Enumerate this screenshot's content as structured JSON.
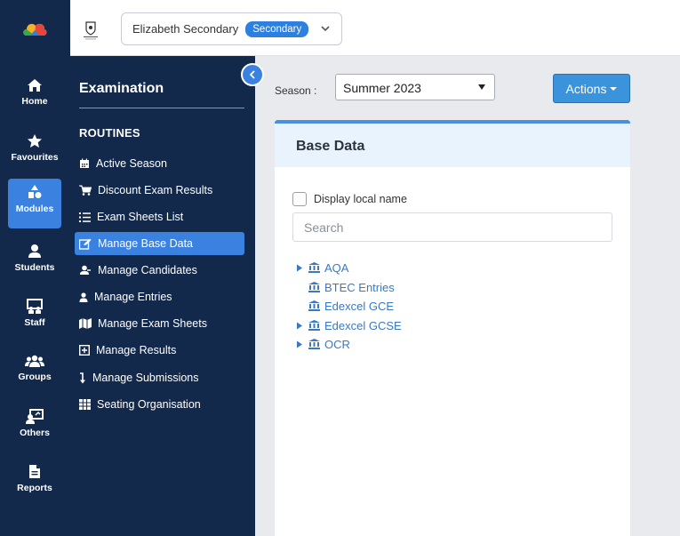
{
  "rail": {
    "items": [
      {
        "label": "Home",
        "icon": "home-icon"
      },
      {
        "label": "Favourites",
        "icon": "star-icon"
      },
      {
        "label": "Modules",
        "icon": "modules-icon",
        "active": true
      },
      {
        "label": "Students",
        "icon": "user-icon"
      },
      {
        "label": "Staff",
        "icon": "staff-icon"
      },
      {
        "label": "Groups",
        "icon": "users-group-icon"
      },
      {
        "label": "Others",
        "icon": "others-icon"
      },
      {
        "label": "Reports",
        "icon": "document-icon"
      }
    ]
  },
  "topbar": {
    "school_name": "Elizabeth Secondary",
    "school_badge": "Secondary"
  },
  "subnav": {
    "title": "Examination",
    "section": "ROUTINES",
    "items": [
      {
        "label": "Active Season",
        "icon": "calendar-icon"
      },
      {
        "label": "Discount Exam Results",
        "icon": "cart-icon"
      },
      {
        "label": "Exam Sheets List",
        "icon": "list-icon"
      },
      {
        "label": "Manage Base Data",
        "icon": "edit-icon",
        "active": true
      },
      {
        "label": "Manage Candidates",
        "icon": "user-slash-icon"
      },
      {
        "label": "Manage Entries",
        "icon": "user-icon"
      },
      {
        "label": "Manage Exam Sheets",
        "icon": "map-icon"
      },
      {
        "label": "Manage Results",
        "icon": "plus-square-icon"
      },
      {
        "label": "Manage Submissions",
        "icon": "level-down-icon"
      },
      {
        "label": "Seating Organisation",
        "icon": "grid-icon"
      }
    ]
  },
  "main": {
    "season_label": "Season :",
    "season_value": "Summer 2023",
    "actions_label": "Actions",
    "panel_title": "Base Data",
    "display_local_name_label": "Display local name",
    "search_placeholder": "Search",
    "tree": [
      {
        "label": "AQA",
        "expandable": true
      },
      {
        "label": "BTEC Entries",
        "expandable": false
      },
      {
        "label": "Edexcel GCE",
        "expandable": false
      },
      {
        "label": "Edexcel GCSE",
        "expandable": true
      },
      {
        "label": "OCR",
        "expandable": true
      }
    ]
  },
  "colors": {
    "sidebar_bg": "#13294b",
    "accent": "#3b82e0",
    "actions_button": "#3b93dc",
    "tree_link": "#3a78c4"
  }
}
